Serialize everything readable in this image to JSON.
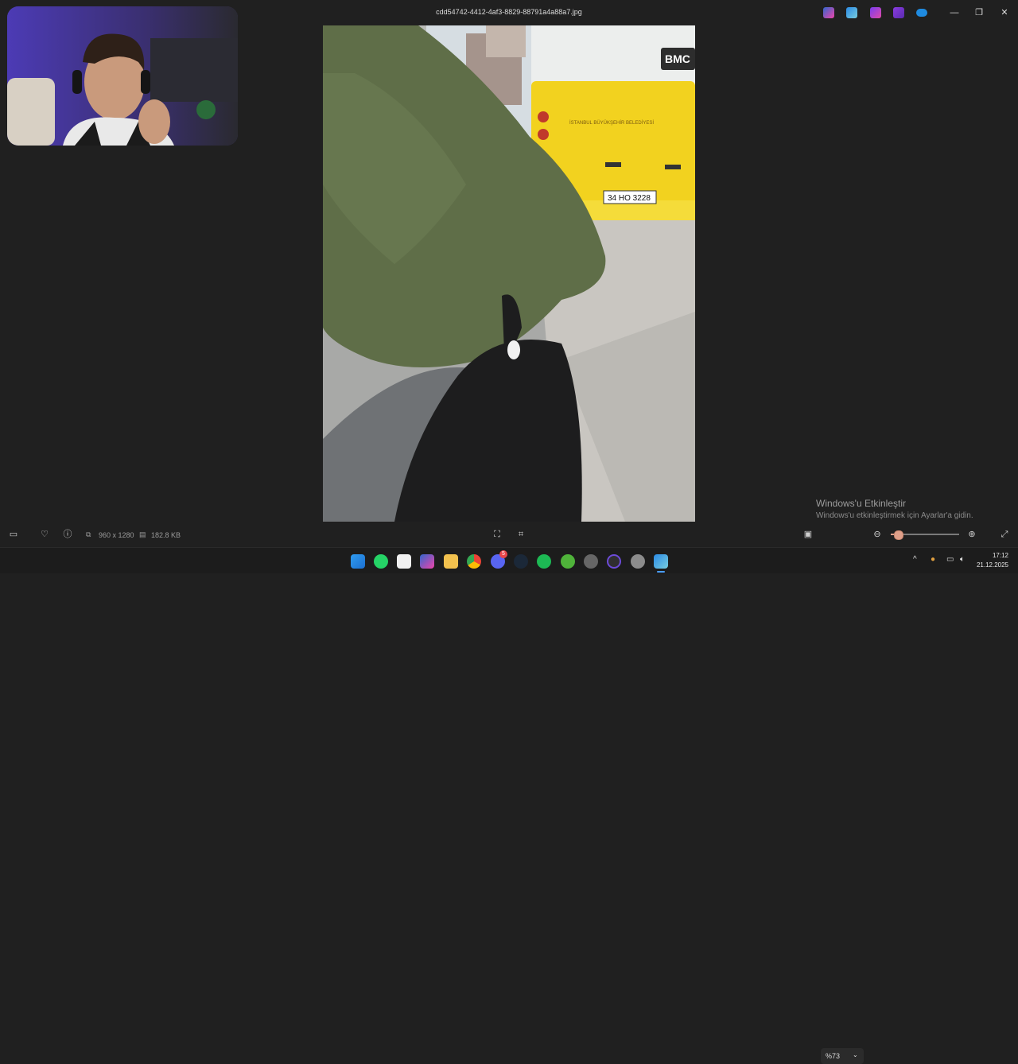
{
  "window": {
    "title": "cdd54742-4412-4af3-8829-88791a4a88a7.jpg",
    "minimize": "—",
    "restore": "❐",
    "close": "✕"
  },
  "photo": {
    "bus_brand": "BMC",
    "bus_plate": "34 HO 3228",
    "bus_logo_text": "İSTANBUL BÜYÜKŞEHİR BELEDİYESİ"
  },
  "statusbar": {
    "dimensions": "960 x 1280",
    "filesize": "182.8 KB",
    "zoom": "%73",
    "zoom_level": 0.1
  },
  "watermark": {
    "line1": "Windows'u Etkinleştir",
    "line2": "Windows'u etkinleştirmek için Ayarlar'a gidin."
  },
  "taskbar": {
    "time": "17:12",
    "date": "21.12.2025",
    "discord_badge": "5"
  },
  "colors": {
    "accent": "#4a9eff",
    "bus_yellow": "#f2d21f",
    "jacket_green": "#5f6e48"
  }
}
